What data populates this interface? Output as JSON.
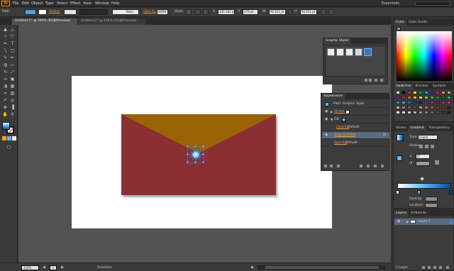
{
  "app": {
    "logo": "Ai",
    "workspace": "Essentials"
  },
  "menu": [
    "File",
    "Edit",
    "Object",
    "Type",
    "Select",
    "Effect",
    "View",
    "Window",
    "Help"
  ],
  "control_bar": {
    "selection": "Path",
    "stroke_label": "Stroke:",
    "brush_value": "Basic",
    "opacity_label": "Opacity:",
    "opacity_value": "100%",
    "style_label": "Style:",
    "x_label": "X:",
    "x_value": "145.181 pt",
    "y_label": "Y:",
    "y_value": "175 pt",
    "w_label": "W:",
    "w_value": "92.611 pt",
    "h_label": "H:",
    "h_value": "92.611 pt"
  },
  "tabs": [
    {
      "label": "Untitled-1* @ 300% (RGB/Preview)"
    },
    {
      "label": "Untitled-2* @ 134% (RGB/Preview)"
    }
  ],
  "graphic_styles": {
    "title": "Graphic Styles"
  },
  "appearance": {
    "title": "Appearance",
    "header": "Path: Graphic Style",
    "rows": [
      {
        "label": "Stroke:",
        "value": ""
      },
      {
        "label": "Fill:",
        "value": ""
      },
      {
        "label": "Opacity:",
        "value": "Default"
      },
      {
        "label": "Drop Shadow",
        "value": ""
      },
      {
        "label": "Opacity:",
        "value": "Default"
      }
    ],
    "fx": "fx"
  },
  "color_panel": {
    "tabs": [
      "Color",
      "Color Guide"
    ]
  },
  "swatches_panel": {
    "tabs": [
      "Swatches",
      "Brushes",
      "Symbols"
    ],
    "colors": [
      "#ffffff",
      "#000000",
      "#ed1c24",
      "#fff200",
      "#00a651",
      "#00aeef",
      "#2e3192",
      "#ec008c",
      "#f7941d",
      "#8dc63f",
      "#662d91",
      "#c1272d",
      "#f15a24",
      "#fbb03b",
      "#d9e021",
      "#8cc63f",
      "#39b54a",
      "#009245",
      "#006837",
      "#22b573",
      "#00a99d",
      "#29abe2",
      "#0071bc",
      "#2e3192",
      "#1b1464",
      "#662d91",
      "#93278f",
      "#9e005d",
      "#d4145a",
      "#ed1e79",
      "#c7b299",
      "#998675",
      "#736357",
      "#534741",
      "#c69c6d",
      "#a67c52",
      "#8c6239",
      "#754c24",
      "#603813",
      "#42210b",
      "#ffffff",
      "#e6e6e6",
      "#cccccc",
      "#b3b3b3",
      "#999999",
      "#808080",
      "#666666",
      "#4d4d4d",
      "#333333",
      "#1a1a1a"
    ]
  },
  "gradient_panel": {
    "tabs": [
      "Stroke",
      "Gradient",
      "Transparency"
    ],
    "type_label": "Type:",
    "type_value": "Linear",
    "stroke_label": "Stroke:",
    "angle_value": "0°",
    "opacity_label": "Opacity:",
    "location_label": "Location:"
  },
  "layers_panel": {
    "tabs": [
      "Layers",
      "Artboards"
    ],
    "layer_name": "Layer 1",
    "count_label": "1 Layer"
  },
  "status_bar": {
    "zoom": "134%",
    "page": "1",
    "tool": "Selection"
  },
  "artwork": {
    "artboard_color": "#ffffff",
    "envelope_body_color": "#8b2f33",
    "envelope_flap_color": "#996306",
    "seal_gradient": [
      "#ffffff",
      "#5bb8ee",
      "#0b4aa4"
    ]
  }
}
